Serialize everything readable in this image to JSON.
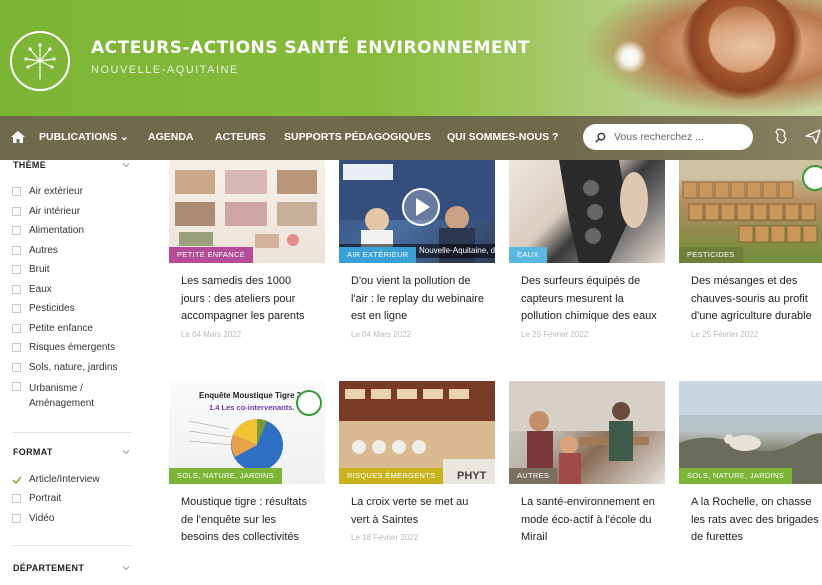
{
  "header": {
    "title": "ACTEURS-ACTIONS SANTÉ ENVIRONNEMENT",
    "subtitle": "NOUVELLE-AQUITAINE"
  },
  "nav": {
    "home_icon": "home-icon",
    "items": [
      {
        "label": "PUBLICATIONS ⌄"
      },
      {
        "label": "AGENDA"
      },
      {
        "label": "ACTEURS"
      },
      {
        "label": "SUPPORTS PÉDAGOGIQUES"
      },
      {
        "label": "QUI SOMMES-NOUS ?"
      }
    ],
    "search_placeholder": "Vous recherchez ..."
  },
  "sidebar": {
    "theme": {
      "heading": "THÈME",
      "options": [
        "Air extérieur",
        "Air intérieur",
        "Alimentation",
        "Autres",
        "Bruit",
        "Eaux",
        "Pesticides",
        "Petite enfance",
        "Risques émergents",
        "Sols, nature, jardins",
        "Urbanisme / Aménagement"
      ]
    },
    "format": {
      "heading": "FORMAT",
      "options": [
        {
          "label": "Article/Interview",
          "checked": true
        },
        {
          "label": "Portrait",
          "checked": false
        },
        {
          "label": "Vidéo",
          "checked": false
        }
      ]
    },
    "departement": {
      "heading": "DÉPARTEMENT"
    }
  },
  "cards": [
    {
      "tag": "PETITE ENFANCE",
      "tag_color": "#b44c9a",
      "title": "Les samedis des 1000 jours : des ateliers pour accompagner les parents",
      "date": "Le 04 Mars 2022"
    },
    {
      "tag": "AIR EXTÉRIEUR",
      "tag_color": "#3aa0d8",
      "title": "D'ou vient la pollution de l'air : le replay du webinaire est en ligne",
      "date": "Le 04 Mars 2022"
    },
    {
      "tag": "EAUX",
      "tag_color": "#5ab8e0",
      "title": "Des surfeurs équipés de capteurs mesurent la pollution chimique des eaux",
      "date": "Le 25 Février 2022"
    },
    {
      "tag": "PESTICIDES",
      "tag_color": "#6e7f3a",
      "title": "Des mésanges et des chauves-souris au profit d'une agriculture durable",
      "date": "Le 25 Février 2022"
    },
    {
      "tag": "SOLS, NATURE, JARDINS",
      "tag_color": "#7cb436",
      "title": "Moustique tigre : résultats de l'enquête sur les besoins des collectivités",
      "date": ""
    },
    {
      "tag": "RISQUES ÉMERGENTS",
      "tag_color": "#c8b21e",
      "title": "La croix verte se met au vert à Saintes",
      "date": "Le 18 Février 2022"
    },
    {
      "tag": "AUTRES",
      "tag_color": "#7b6f5e",
      "title": "La santé-environnement en mode éco-actif à l'école du Mirail",
      "date": ""
    },
    {
      "tag": "SOLS, NATURE, JARDINS",
      "tag_color": "#7cb436",
      "title": "A la Rochelle, on chasse les rats avec des brigades de furettes",
      "date": ""
    }
  ],
  "card_images": {
    "video_caption": "Nouvelle-Aquitaine, d'où vi",
    "survey_title": "Enquête Moustique Tigre 2",
    "survey_subtitle": "1.4 Les co-intervenants.",
    "shop_sign": "PHYT"
  }
}
